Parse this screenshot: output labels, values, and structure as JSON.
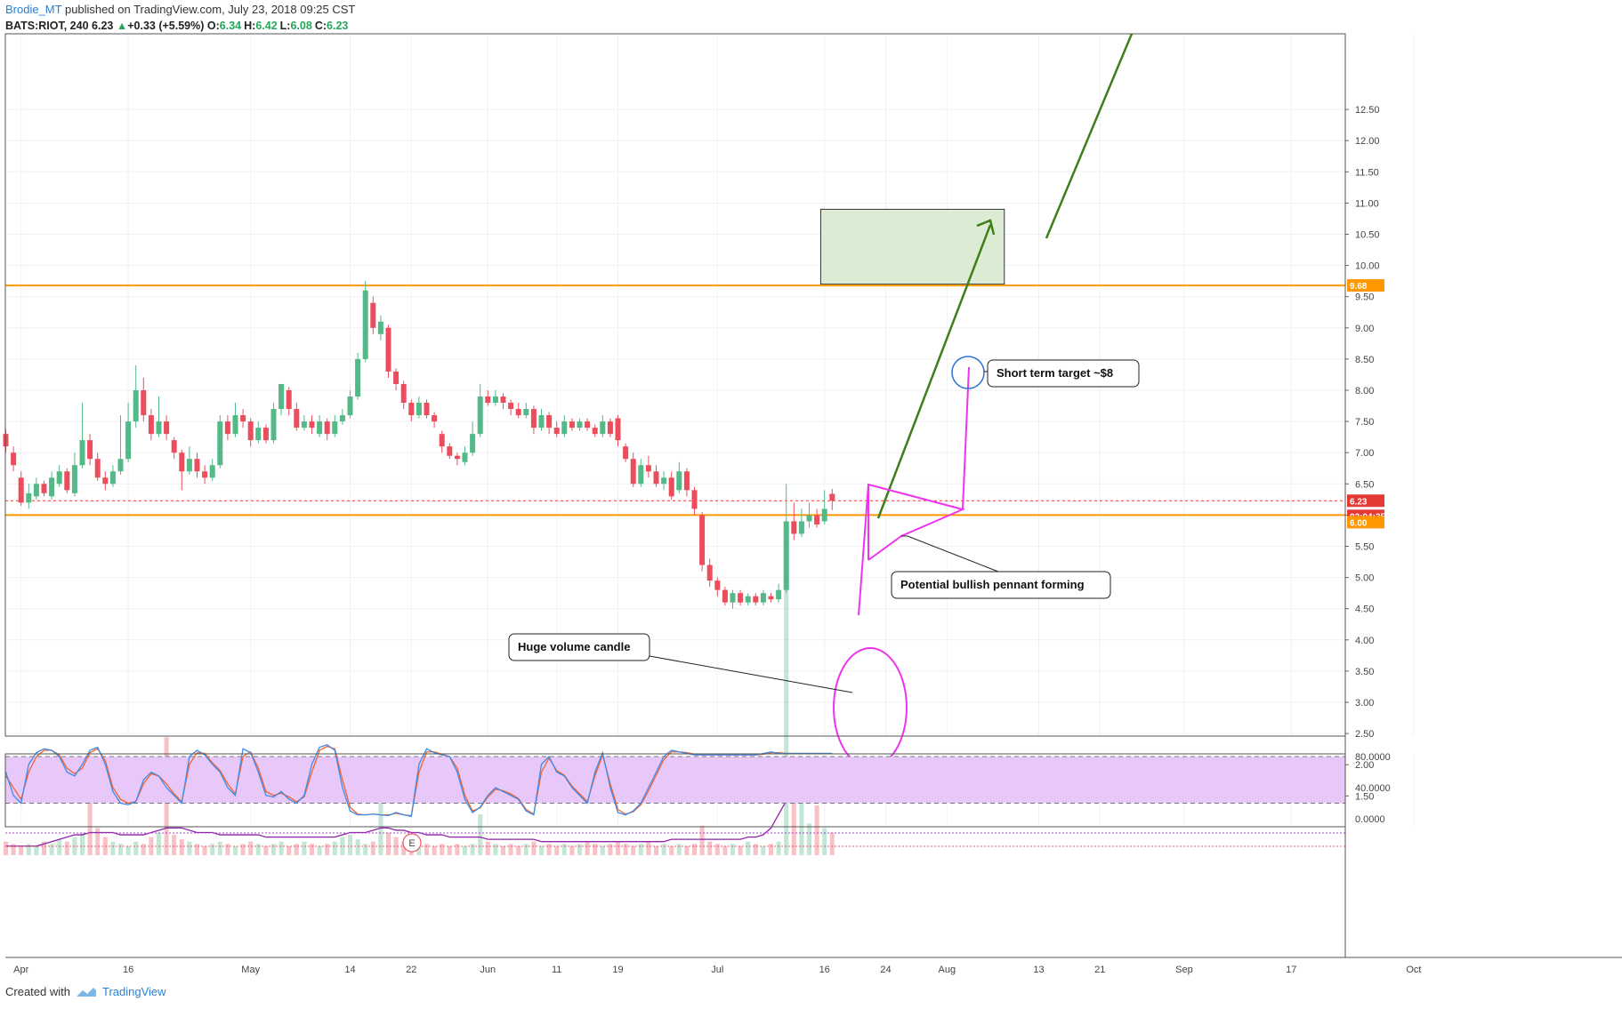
{
  "header": {
    "author": "Brodie_MT",
    "published": "published on TradingView.com, July 23, 2018 09:25 CST",
    "symbol": "BATS:RIOT, 240",
    "last": "6.23",
    "arrow": "▲",
    "change": "+0.33 (+5.59%)",
    "o_label": "O:",
    "o_value": "6.34",
    "h_label": "H:",
    "h_value": "6.42",
    "l_label": "L:",
    "l_value": "6.08",
    "c_label": "C:",
    "c_value": "6.23"
  },
  "footer": {
    "created_with": "Created with",
    "brand": "TradingView"
  },
  "badges": {
    "resistance": "9.68",
    "current": "6.23",
    "countdown": "02:04:35",
    "support": "6.00"
  },
  "annotations": {
    "short_target": "Short term target ~$8",
    "pennant": "Potential bullish pennant forming",
    "volume": "Huge volume candle",
    "earnings": "E"
  },
  "colors": {
    "up": "#53b987",
    "down": "#eb4d5c",
    "orange": "#ff9800",
    "magenta": "#ee33ee",
    "green_arrow": "#3f7e1a",
    "target_box": "#dcebd3",
    "stoch_fill": "#e8c8f8",
    "stoch_k": "#3d8ce8",
    "stoch_d": "#f4622c",
    "current_line": "#e33"
  },
  "chart_data": {
    "type": "candlestick",
    "price_axis": {
      "ticks": [
        1.5,
        2.0,
        2.5,
        3.0,
        3.5,
        4.0,
        4.5,
        5.0,
        5.5,
        6.0,
        6.5,
        7.0,
        7.5,
        8.0,
        8.5,
        9.0,
        9.5,
        10.0,
        10.5,
        11.0,
        11.5,
        12.0,
        12.5
      ],
      "labels": [
        "1.50",
        "2.00",
        "2.50",
        "3.00",
        "3.50",
        "4.00",
        "4.50",
        "5.00",
        "5.50",
        "6.00",
        "6.50",
        "7.00",
        "7.50",
        "8.00",
        "8.50",
        "9.00",
        "9.50",
        "10.00",
        "10.50",
        "11.00",
        "11.50",
        "12.00",
        "12.50"
      ]
    },
    "time_axis": {
      "labels": [
        "Apr",
        "16",
        "May",
        "14",
        "22",
        "Jun",
        "11",
        "19",
        "Jul",
        "16",
        "24",
        "Aug",
        "13",
        "21",
        "Sep",
        "17",
        "Oct"
      ],
      "days": [
        2,
        16,
        32,
        45,
        53,
        63,
        72,
        80,
        93,
        107,
        115,
        123,
        135,
        143,
        154,
        168,
        184
      ]
    },
    "levels": {
      "resistance": 9.68,
      "support": 6.0,
      "current": 6.23
    },
    "target_zone": {
      "low": 9.7,
      "high": 10.9,
      "start_day": 106.5,
      "end_day": 130.5
    },
    "candles": [
      [
        0,
        7.3,
        7.1,
        7.38,
        7.0
      ],
      [
        1,
        7.0,
        6.8,
        7.1,
        6.7
      ],
      [
        2,
        6.6,
        6.2,
        6.7,
        6.15
      ],
      [
        3,
        6.2,
        6.35,
        6.5,
        6.1
      ],
      [
        4,
        6.3,
        6.5,
        6.6,
        6.25
      ],
      [
        5,
        6.5,
        6.35,
        6.55,
        6.3
      ],
      [
        6,
        6.3,
        6.6,
        6.7,
        6.25
      ],
      [
        7,
        6.5,
        6.7,
        6.8,
        6.45
      ],
      [
        8,
        6.7,
        6.4,
        6.75,
        6.35
      ],
      [
        9,
        6.35,
        6.8,
        7.0,
        6.3
      ],
      [
        10,
        6.8,
        7.2,
        7.8,
        6.75
      ],
      [
        11,
        7.2,
        6.9,
        7.3,
        6.8
      ],
      [
        12,
        6.9,
        6.6,
        7.0,
        6.55
      ],
      [
        13,
        6.6,
        6.5,
        6.7,
        6.4
      ],
      [
        14,
        6.5,
        6.7,
        6.8,
        6.45
      ],
      [
        15,
        6.7,
        6.9,
        7.6,
        6.65
      ],
      [
        16,
        6.9,
        7.5,
        7.8,
        6.85
      ],
      [
        17,
        7.5,
        8.0,
        8.4,
        7.4
      ],
      [
        18,
        8.0,
        7.6,
        8.2,
        7.5
      ],
      [
        19,
        7.6,
        7.3,
        7.7,
        7.2
      ],
      [
        20,
        7.3,
        7.5,
        7.9,
        7.25
      ],
      [
        21,
        7.5,
        7.3,
        7.6,
        7.2
      ],
      [
        22,
        7.2,
        7.0,
        7.25,
        6.9
      ],
      [
        23,
        7.0,
        6.7,
        7.05,
        6.4
      ],
      [
        24,
        6.7,
        6.9,
        7.1,
        6.65
      ],
      [
        25,
        6.9,
        6.7,
        7.0,
        6.6
      ],
      [
        26,
        6.7,
        6.6,
        6.8,
        6.5
      ],
      [
        27,
        6.6,
        6.8,
        6.9,
        6.55
      ],
      [
        28,
        6.8,
        7.5,
        7.6,
        6.75
      ],
      [
        29,
        7.5,
        7.3,
        7.6,
        7.2
      ],
      [
        30,
        7.3,
        7.6,
        7.8,
        7.25
      ],
      [
        31,
        7.6,
        7.5,
        7.7,
        7.4
      ],
      [
        32,
        7.5,
        7.2,
        7.55,
        7.1
      ],
      [
        33,
        7.2,
        7.4,
        7.5,
        7.15
      ],
      [
        34,
        7.4,
        7.2,
        7.45,
        7.15
      ],
      [
        35,
        7.2,
        7.7,
        7.8,
        7.15
      ],
      [
        36,
        7.7,
        8.1,
        8.1,
        7.6
      ],
      [
        37,
        8.0,
        7.7,
        8.05,
        7.6
      ],
      [
        38,
        7.7,
        7.4,
        7.8,
        7.35
      ],
      [
        39,
        7.4,
        7.5,
        7.6,
        7.35
      ],
      [
        40,
        7.5,
        7.4,
        7.6,
        7.3
      ],
      [
        41,
        7.3,
        7.5,
        7.6,
        7.25
      ],
      [
        42,
        7.5,
        7.3,
        7.55,
        7.2
      ],
      [
        43,
        7.3,
        7.5,
        7.6,
        7.25
      ],
      [
        44,
        7.5,
        7.6,
        7.7,
        7.45
      ],
      [
        45,
        7.6,
        7.9,
        8.0,
        7.55
      ],
      [
        46,
        7.9,
        8.5,
        8.6,
        7.85
      ],
      [
        47,
        8.5,
        9.6,
        9.75,
        8.45
      ],
      [
        48,
        9.4,
        9.0,
        9.5,
        8.9
      ],
      [
        49,
        8.9,
        9.1,
        9.2,
        8.8
      ],
      [
        50,
        9.0,
        8.3,
        9.05,
        8.2
      ],
      [
        51,
        8.3,
        8.1,
        8.35,
        8.0
      ],
      [
        52,
        8.1,
        7.8,
        8.15,
        7.7
      ],
      [
        53,
        7.8,
        7.6,
        7.85,
        7.5
      ],
      [
        54,
        7.6,
        7.8,
        7.9,
        7.55
      ],
      [
        55,
        7.8,
        7.6,
        7.85,
        7.55
      ],
      [
        56,
        7.6,
        7.5,
        7.65,
        7.4
      ],
      [
        57,
        7.3,
        7.1,
        7.35,
        7.0
      ],
      [
        58,
        7.1,
        6.95,
        7.15,
        6.9
      ],
      [
        59,
        6.95,
        6.9,
        7.0,
        6.8
      ],
      [
        60,
        6.85,
        7.0,
        7.1,
        6.8
      ],
      [
        61,
        7.0,
        7.3,
        7.5,
        6.95
      ],
      [
        62,
        7.3,
        7.9,
        8.1,
        7.25
      ],
      [
        63,
        7.9,
        7.8,
        8.0,
        7.75
      ],
      [
        64,
        7.8,
        7.9,
        8.0,
        7.75
      ],
      [
        65,
        7.9,
        7.8,
        7.95,
        7.7
      ],
      [
        66,
        7.8,
        7.7,
        7.85,
        7.6
      ],
      [
        67,
        7.7,
        7.6,
        7.8,
        7.55
      ],
      [
        68,
        7.6,
        7.7,
        7.8,
        7.55
      ],
      [
        69,
        7.7,
        7.4,
        7.75,
        7.3
      ],
      [
        70,
        7.4,
        7.6,
        7.7,
        7.35
      ],
      [
        71,
        7.6,
        7.4,
        7.65,
        7.3
      ],
      [
        72,
        7.4,
        7.3,
        7.5,
        7.25
      ],
      [
        73,
        7.3,
        7.5,
        7.6,
        7.25
      ],
      [
        74,
        7.5,
        7.4,
        7.55,
        7.35
      ],
      [
        75,
        7.4,
        7.5,
        7.55,
        7.35
      ],
      [
        76,
        7.5,
        7.4,
        7.55,
        7.35
      ],
      [
        77,
        7.4,
        7.3,
        7.45,
        7.25
      ],
      [
        78,
        7.3,
        7.5,
        7.6,
        7.25
      ],
      [
        79,
        7.5,
        7.3,
        7.55,
        7.25
      ],
      [
        80,
        7.55,
        7.2,
        7.6,
        7.1
      ],
      [
        81,
        7.1,
        6.9,
        7.15,
        6.85
      ],
      [
        82,
        6.9,
        6.5,
        7.0,
        6.45
      ],
      [
        83,
        6.5,
        6.8,
        6.9,
        6.45
      ],
      [
        84,
        6.8,
        6.7,
        6.95,
        6.6
      ],
      [
        85,
        6.7,
        6.5,
        6.8,
        6.45
      ],
      [
        86,
        6.5,
        6.6,
        6.7,
        6.4
      ],
      [
        87,
        6.6,
        6.3,
        6.7,
        6.25
      ],
      [
        88,
        6.4,
        6.7,
        6.85,
        6.35
      ],
      [
        89,
        6.7,
        6.4,
        6.75,
        6.3
      ],
      [
        90,
        6.4,
        6.1,
        6.45,
        6.0
      ],
      [
        91,
        6.0,
        5.2,
        6.05,
        5.1
      ],
      [
        92,
        5.2,
        4.95,
        5.3,
        4.85
      ],
      [
        93,
        4.95,
        4.8,
        5.0,
        4.7
      ],
      [
        94,
        4.8,
        4.6,
        4.85,
        4.55
      ],
      [
        95,
        4.6,
        4.75,
        4.8,
        4.5
      ],
      [
        96,
        4.75,
        4.6,
        4.8,
        4.55
      ],
      [
        97,
        4.6,
        4.7,
        4.75,
        4.55
      ],
      [
        98,
        4.7,
        4.6,
        4.75,
        4.55
      ],
      [
        99,
        4.6,
        4.75,
        4.8,
        4.55
      ],
      [
        100,
        4.7,
        4.65,
        4.75,
        4.6
      ],
      [
        101,
        4.65,
        4.8,
        4.9,
        4.6
      ],
      [
        102,
        4.8,
        5.9,
        6.5,
        4.75
      ],
      [
        103,
        5.9,
        5.7,
        6.2,
        5.6
      ],
      [
        104,
        5.7,
        5.9,
        6.1,
        5.65
      ],
      [
        105,
        5.9,
        6.0,
        6.2,
        5.8
      ],
      [
        106,
        6.0,
        5.85,
        6.1,
        5.8
      ],
      [
        107,
        5.9,
        6.1,
        6.4,
        5.85
      ],
      [
        108,
        6.34,
        6.23,
        6.42,
        6.08
      ]
    ],
    "volume": [
      6,
      5,
      4,
      5,
      4,
      6,
      5,
      7,
      6,
      8,
      10,
      44,
      12,
      8,
      6,
      5,
      4,
      6,
      5,
      8,
      10,
      52,
      9,
      7,
      6,
      5,
      4,
      5,
      6,
      5,
      4,
      5,
      6,
      5,
      4,
      5,
      6,
      4,
      5,
      6,
      5,
      4,
      5,
      6,
      8,
      9,
      7,
      5,
      6,
      26,
      10,
      8,
      6,
      5,
      6,
      5,
      4,
      5,
      4,
      5,
      4,
      5,
      18,
      6,
      5,
      4,
      5,
      4,
      5,
      6,
      4,
      5,
      4,
      5,
      4,
      5,
      6,
      5,
      4,
      5,
      6,
      5,
      4,
      5,
      6,
      4,
      5,
      4,
      5,
      4,
      5,
      13,
      6,
      5,
      4,
      5,
      4,
      6,
      5,
      4,
      5,
      6,
      135,
      40,
      25,
      14,
      22,
      12,
      10
    ],
    "volume_ma": [
      4,
      4,
      4,
      4,
      4,
      5,
      6,
      7,
      8,
      9,
      9,
      10,
      10,
      10,
      10,
      9,
      9,
      9,
      9,
      10,
      11,
      12,
      12,
      12,
      11,
      10,
      10,
      10,
      9,
      9,
      9,
      9,
      9,
      9,
      8,
      8,
      8,
      8,
      8,
      8,
      8,
      8,
      8,
      8,
      9,
      10,
      10,
      10,
      11,
      12,
      12,
      11,
      11,
      10,
      10,
      9,
      9,
      9,
      8,
      8,
      8,
      8,
      8,
      7,
      7,
      7,
      7,
      7,
      7,
      7,
      6,
      6,
      6,
      6,
      6,
      6,
      6,
      6,
      6,
      6,
      6,
      6,
      6,
      6,
      6,
      6,
      6,
      7,
      7,
      7,
      7,
      7,
      7,
      7,
      7,
      7,
      7,
      8,
      8,
      9,
      12,
      18,
      24,
      28,
      30,
      31,
      31
    ],
    "stoch_k": [
      60,
      30,
      20,
      70,
      85,
      90,
      88,
      80,
      60,
      55,
      70,
      88,
      92,
      70,
      35,
      20,
      18,
      22,
      50,
      60,
      55,
      40,
      30,
      20,
      80,
      88,
      82,
      70,
      60,
      40,
      30,
      90,
      85,
      60,
      30,
      28,
      35,
      25,
      20,
      30,
      70,
      92,
      95,
      88,
      40,
      10,
      5,
      5,
      6,
      5,
      4,
      8,
      5,
      3,
      70,
      90,
      85,
      82,
      80,
      60,
      25,
      8,
      15,
      30,
      40,
      35,
      30,
      25,
      10,
      5,
      70,
      80,
      60,
      55,
      40,
      30,
      20,
      60,
      85,
      40,
      8,
      5,
      10,
      20,
      40,
      60,
      80,
      88,
      86,
      84,
      82,
      82,
      82,
      82,
      82,
      82,
      82,
      82,
      82,
      84,
      86,
      84,
      84,
      84,
      84,
      84,
      84,
      84,
      84
    ],
    "stoch_d": [
      55,
      40,
      25,
      60,
      80,
      88,
      88,
      82,
      65,
      58,
      65,
      85,
      90,
      75,
      40,
      25,
      20,
      22,
      45,
      58,
      55,
      45,
      32,
      22,
      70,
      85,
      84,
      72,
      62,
      45,
      32,
      80,
      86,
      65,
      35,
      30,
      33,
      28,
      22,
      28,
      60,
      88,
      93,
      90,
      50,
      15,
      6,
      5,
      6,
      5,
      5,
      7,
      5,
      4,
      60,
      86,
      86,
      83,
      80,
      65,
      30,
      10,
      14,
      28,
      38,
      36,
      32,
      26,
      12,
      6,
      60,
      78,
      62,
      56,
      42,
      32,
      22,
      55,
      82,
      45,
      12,
      6,
      9,
      18,
      36,
      56,
      76,
      86,
      86,
      85,
      83,
      82,
      82,
      82,
      82,
      82,
      82,
      82,
      82,
      83,
      85,
      85,
      84,
      84,
      84,
      84,
      84,
      84,
      84
    ],
    "stoch_axis": {
      "labels": [
        "80.0000",
        "40.0000",
        "0.0000"
      ],
      "values": [
        80,
        40,
        0
      ]
    }
  }
}
